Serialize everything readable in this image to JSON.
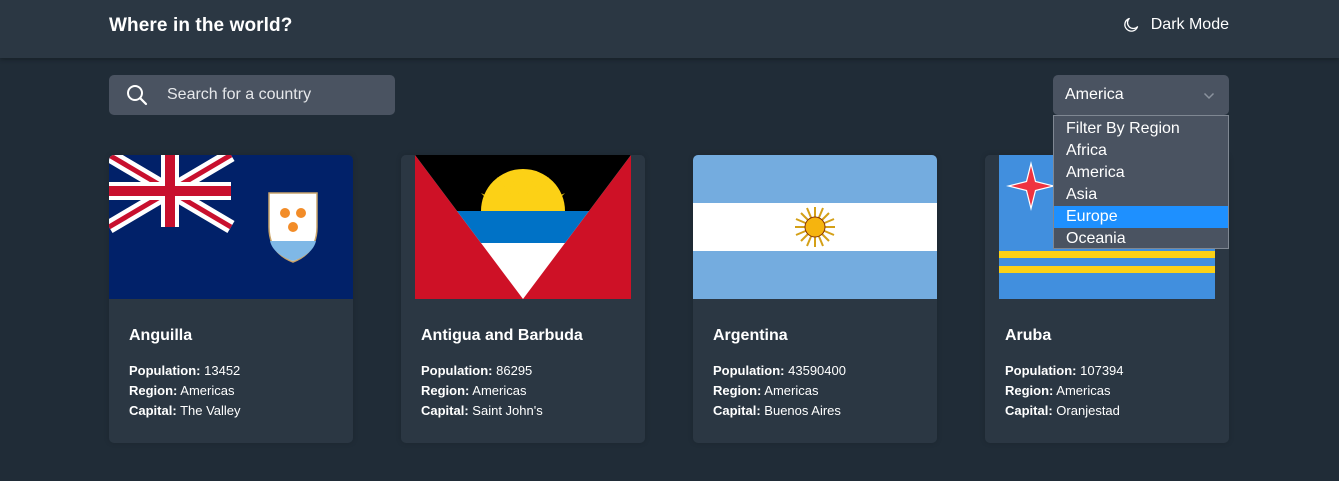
{
  "header": {
    "title": "Where in the world?",
    "mode_toggle_label": "Dark Mode"
  },
  "search": {
    "placeholder": "Search for a country",
    "value": ""
  },
  "region_filter": {
    "selected": "America",
    "options": [
      "Filter By Region",
      "Africa",
      "America",
      "Asia",
      "Europe",
      "Oceania"
    ],
    "highlighted": "Europe"
  },
  "labels": {
    "population": "Population:",
    "region": "Region:",
    "capital": "Capital:"
  },
  "countries": [
    {
      "name": "Anguilla",
      "population": "13452",
      "region": "Americas",
      "capital": "The Valley"
    },
    {
      "name": "Antigua and Barbuda",
      "population": "86295",
      "region": "Americas",
      "capital": "Saint John's"
    },
    {
      "name": "Argentina",
      "population": "43590400",
      "region": "Americas",
      "capital": "Buenos Aires"
    },
    {
      "name": "Aruba",
      "population": "107394",
      "region": "Americas",
      "capital": "Oranjestad"
    }
  ],
  "colors": {
    "background": "#202c37",
    "surface": "#2b3743",
    "input": "#4a5361",
    "highlight": "#1e90ff"
  }
}
